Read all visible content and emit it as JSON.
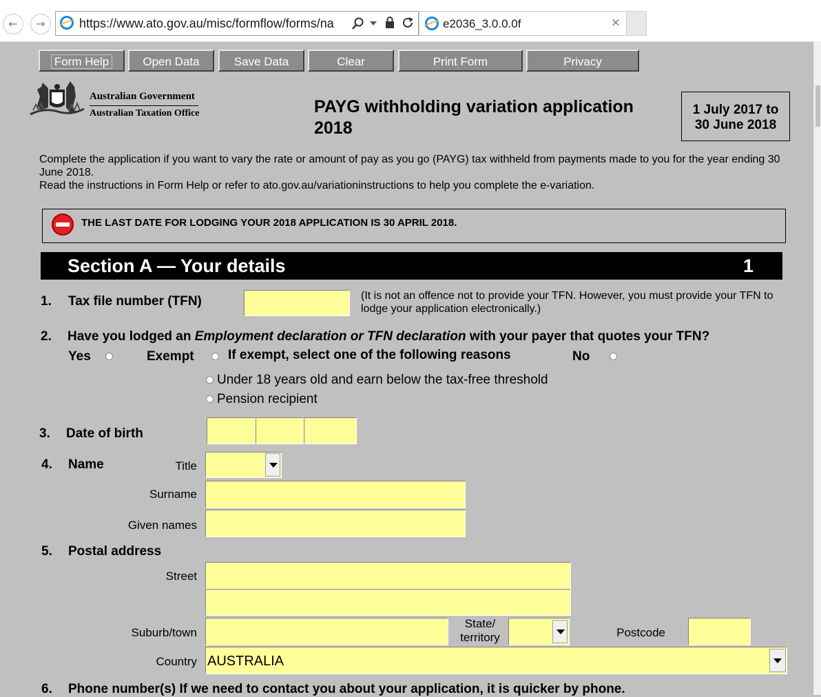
{
  "browser": {
    "url": "https://www.ato.gov.au/misc/formflow/forms/na",
    "tab_title": "e2036_3.0.0.0f",
    "back_glyph": "←",
    "forward_glyph": "→",
    "tab_close_glyph": "×",
    "icons": [
      "back-arrow-icon",
      "forward-arrow-icon",
      "ie-logo-icon",
      "search-icon",
      "dropdown-icon",
      "lock-icon",
      "refresh-icon",
      "close-icon"
    ]
  },
  "toolbar": {
    "form_help": "Form Help",
    "open_data": "Open Data",
    "save_data": "Save Data",
    "clear": "Clear",
    "print_form": "Print Form",
    "privacy": "Privacy"
  },
  "header": {
    "agency_line1": "Australian Government",
    "agency_line2": "Australian Taxation Office",
    "form_title": "PAYG withholding variation application 2018",
    "period_line1": "1 July 2017 to",
    "period_line2": "30 June 2018"
  },
  "intro": {
    "line1": "Complete the application if you want to vary the rate or amount of pay as you go (PAYG) tax withheld from payments made to you for the year ending 30 June 2018.",
    "line2": "Read the instructions in Form Help or refer to ato.gov.au/variationinstructions to help you complete the e-variation."
  },
  "notice": {
    "text": "THE LAST DATE FOR LODGING YOUR 2018 APPLICATION IS 30 APRIL 2018."
  },
  "section": {
    "title": "Section A — Your details",
    "page_number": "1"
  },
  "questions": {
    "q1": {
      "number": "1.",
      "label": "Tax file number (TFN)",
      "note": "(It is not an offence not to provide your TFN. However, you must provide your TFN to lodge your application electronically.)",
      "value": ""
    },
    "q2": {
      "number": "2.",
      "label_pre": "Have you lodged an ",
      "label_em": "Employment declaration or TFN declaration",
      "label_post": " with your payer that quotes your TFN?",
      "yes": "Yes",
      "exempt": "Exempt",
      "exempt_prompt": "If exempt, select one of the following reasons",
      "no": "No",
      "reason1": "Under 18 years old and earn below the tax-free threshold",
      "reason2": "Pension recipient"
    },
    "q3": {
      "number": "3.",
      "label": "Date of birth"
    },
    "q4": {
      "number": "4.",
      "label": "Name",
      "title_label": "Title",
      "surname_label": "Surname",
      "given_names_label": "Given names"
    },
    "q5": {
      "number": "5.",
      "label": "Postal address",
      "street_label": "Street",
      "suburb_label": "Suburb/town",
      "state_label_1": "State/",
      "state_label_2": "territory",
      "postcode_label": "Postcode",
      "country_label": "Country",
      "country_value": "AUSTRALIA"
    },
    "q6": {
      "number": "6.",
      "label": "Phone number(s) If we need to contact you about your application, it is quicker by phone."
    }
  }
}
